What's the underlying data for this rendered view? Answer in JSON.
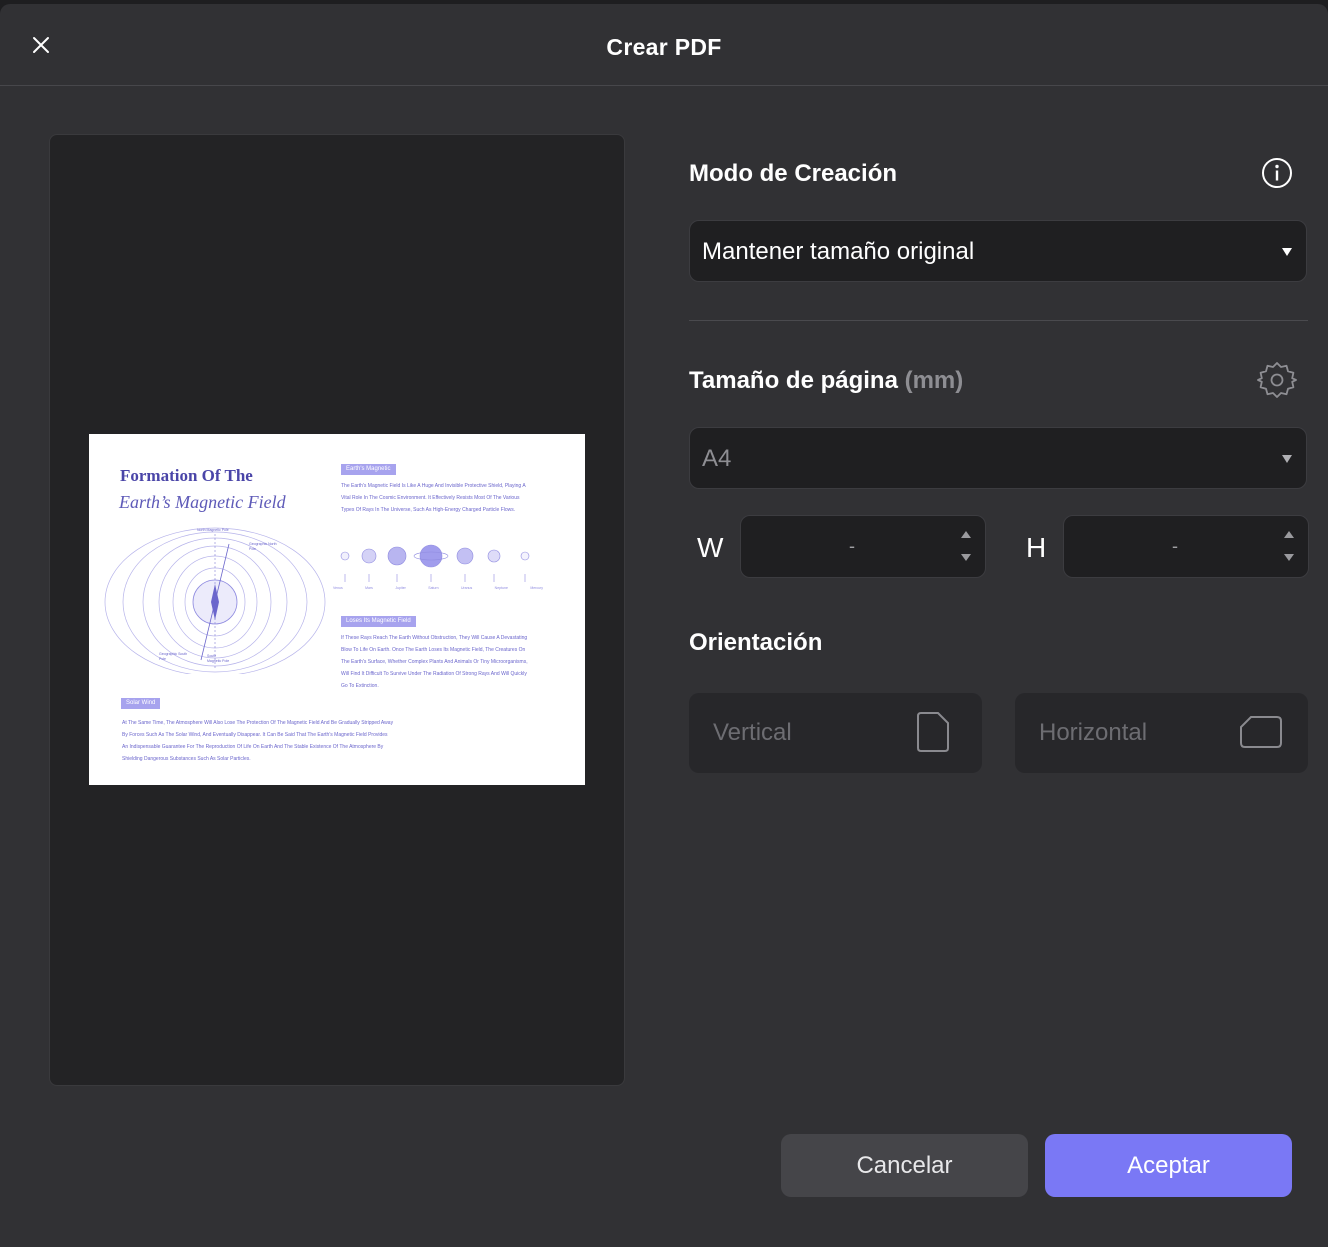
{
  "dialog": {
    "title": "Crear PDF"
  },
  "preview": {
    "doc_title_line1": "Formation Of The",
    "doc_title_line2": "Earth’s Magnetic Field",
    "tag1": "Earth's Magnetic",
    "tag2": "Loses Its Magnetic Field",
    "tag3": "Solar Wind",
    "para1": "The Earth's Magnetic Field Is Like A Huge And Invisible Protective Shield, Playing A Vital Role In The Cosmic Environment. It Effectively Resists Most Of The Various Types Of Rays In The Universe, Such As High-Energy Charged Particle Flows.",
    "para2": "If These Rays Reach The Earth Without Obstruction, They Will Cause A Devastating Blow To Life On Earth. Once The Earth Loses Its Magnetic Field, The Creatures On The Earth's Surface, Whether Complex Plants And Animals Or Tiny Microorganisms, Will Find It Difficult To Survive Under The Radiation Of Strong Rays And Will Quickly Go To Extinction.",
    "para3": "At The Same Time, The Atmosphere Will Also Lose The Protection Of The Magnetic Field And Be Gradually Stripped Away By Forces Such As The Solar Wind, And Eventually Disappear. It Can Be Said That The Earth's Magnetic Field Provides An Indispensable Guarantee For The Reproduction Of Life On Earth And The Stable Existence Of The Atmosphere By Shielding Dangerous Substances Such As Solar Particles.",
    "planets": [
      "Venus",
      "Mars",
      "Jupiter",
      "Saturn",
      "Uranus",
      "Neptune",
      "Mercury"
    ],
    "diagram_labels": {
      "north_mag": "North Magnetic Pole",
      "geo_north": "Geographic North Pole",
      "geo_south": "Geographic South Pole",
      "south_mag": "South Magnetic Pole"
    }
  },
  "creation_mode": {
    "heading": "Modo de Creación",
    "selected": "Mantener tamaño original"
  },
  "page_size": {
    "heading": "Tamaño de página",
    "unit": "(mm)",
    "selected": "A4",
    "width_label": "W",
    "width_value": "-",
    "height_label": "H",
    "height_value": "-"
  },
  "orientation": {
    "heading": "Orientación",
    "vertical_label": "Vertical",
    "horizontal_label": "Horizontal"
  },
  "footer": {
    "cancel_label": "Cancelar",
    "accept_label": "Aceptar"
  },
  "colors": {
    "dialog_bg": "#313134",
    "field_bg": "#1f1f21",
    "accent": "#7a78f5",
    "doc_purple": "#5e5ab8"
  }
}
